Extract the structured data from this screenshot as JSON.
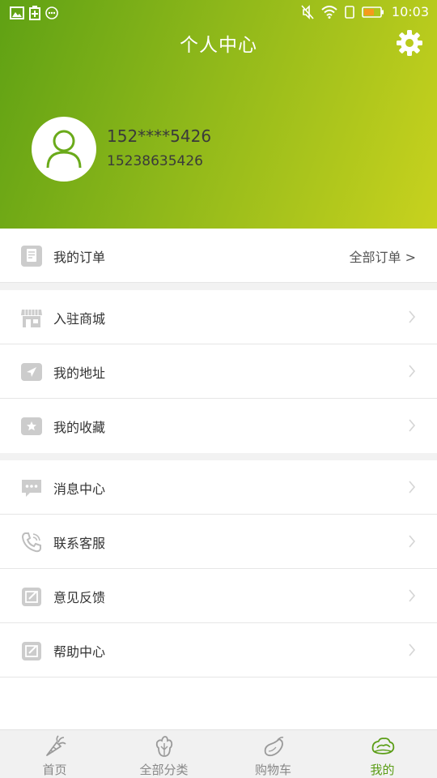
{
  "status_bar": {
    "time": "10:03"
  },
  "header": {
    "title": "个人中心"
  },
  "profile": {
    "name": "152****5426",
    "phone": "15238635426"
  },
  "orders": {
    "label": "我的订单",
    "all_label": "全部订单 >"
  },
  "menu_group_1": [
    {
      "label": "入驻商城",
      "icon": "store-icon"
    },
    {
      "label": "我的地址",
      "icon": "location-arrow-icon"
    },
    {
      "label": "我的收藏",
      "icon": "star-icon"
    }
  ],
  "menu_group_2": [
    {
      "label": "消息中心",
      "icon": "message-icon"
    },
    {
      "label": "联系客服",
      "icon": "phone-icon"
    },
    {
      "label": "意见反馈",
      "icon": "feedback-icon"
    },
    {
      "label": "帮助中心",
      "icon": "help-icon"
    }
  ],
  "tabs": [
    {
      "label": "首页",
      "icon": "carrot-icon",
      "active": false
    },
    {
      "label": "全部分类",
      "icon": "cabbage-icon",
      "active": false
    },
    {
      "label": "购物车",
      "icon": "eggplant-icon",
      "active": false
    },
    {
      "label": "我的",
      "icon": "leafy-icon",
      "active": true
    }
  ],
  "colors": {
    "accent": "#5a9d15",
    "header_start": "#5fa114",
    "header_end": "#c8d21e"
  }
}
